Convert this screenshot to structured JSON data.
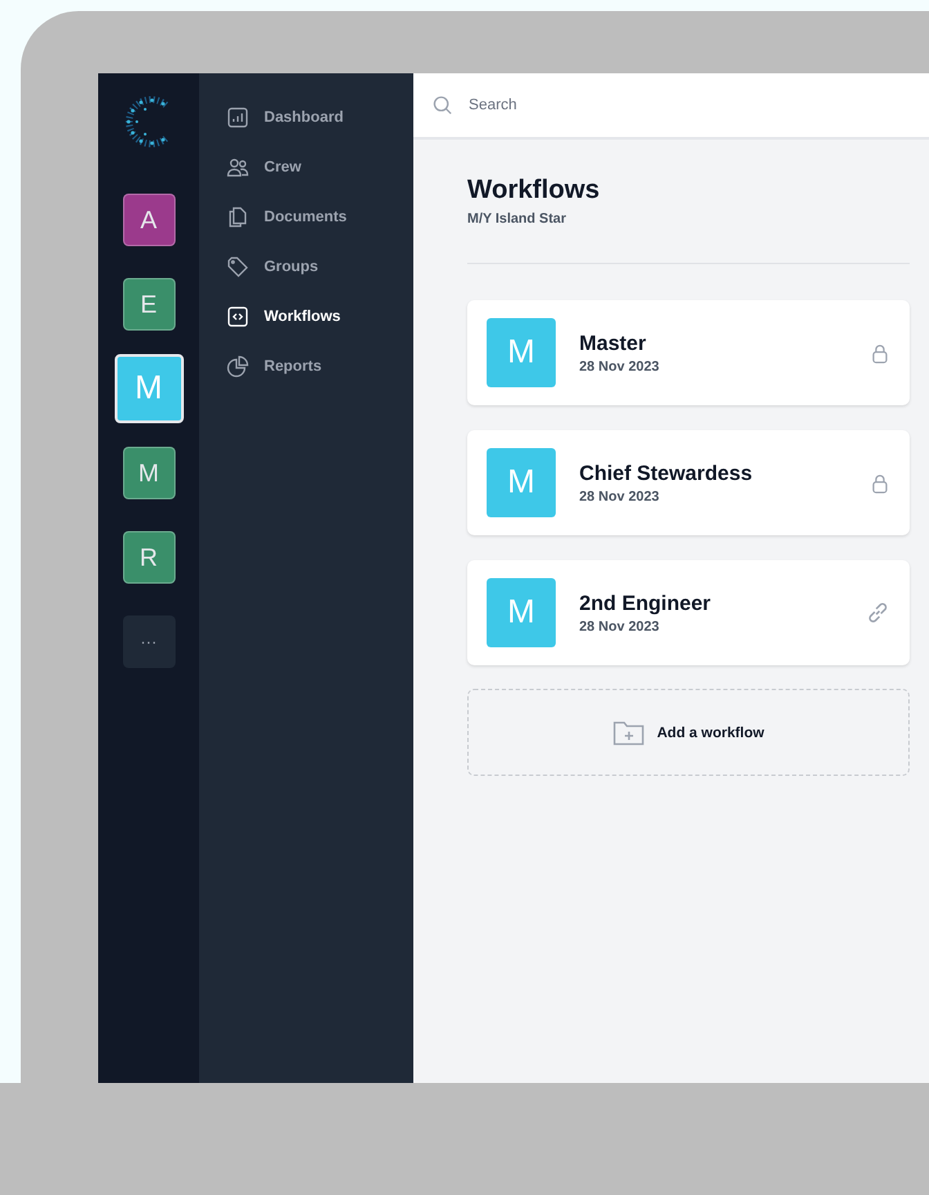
{
  "workspaces": [
    {
      "letter": "A",
      "color": "#9b3a8c",
      "selected": false
    },
    {
      "letter": "E",
      "color": "#3a8f6a",
      "selected": false
    },
    {
      "letter": "M",
      "color": "#3ec8e8",
      "selected": true
    },
    {
      "letter": "M",
      "color": "#3a8f6a",
      "selected": false
    },
    {
      "letter": "R",
      "color": "#3a8f6a",
      "selected": false
    }
  ],
  "more_button": "···",
  "nav": [
    {
      "label": "Dashboard",
      "kind": "chart",
      "selected": false
    },
    {
      "label": "Crew",
      "kind": "people",
      "selected": false
    },
    {
      "label": "Documents",
      "kind": "pages",
      "selected": false
    },
    {
      "label": "Groups",
      "kind": "tag",
      "selected": false
    },
    {
      "label": "Workflows",
      "kind": "code",
      "selected": true
    },
    {
      "label": "Reports",
      "kind": "pie",
      "selected": false
    }
  ],
  "search": {
    "placeholder": "Search"
  },
  "page": {
    "title": "Workflows",
    "subtitle": "M/Y Island Star"
  },
  "workflows": [
    {
      "letter": "M",
      "name": "Master",
      "date": "28 Nov 2023",
      "kind": "locked"
    },
    {
      "letter": "M",
      "name": "Chief Stewardess",
      "date": "28 Nov 2023",
      "kind": "locked"
    },
    {
      "letter": "M",
      "name": "2nd Engineer",
      "date": "28 Nov 2023",
      "kind": "linked"
    }
  ],
  "add_button": "Add a workflow"
}
